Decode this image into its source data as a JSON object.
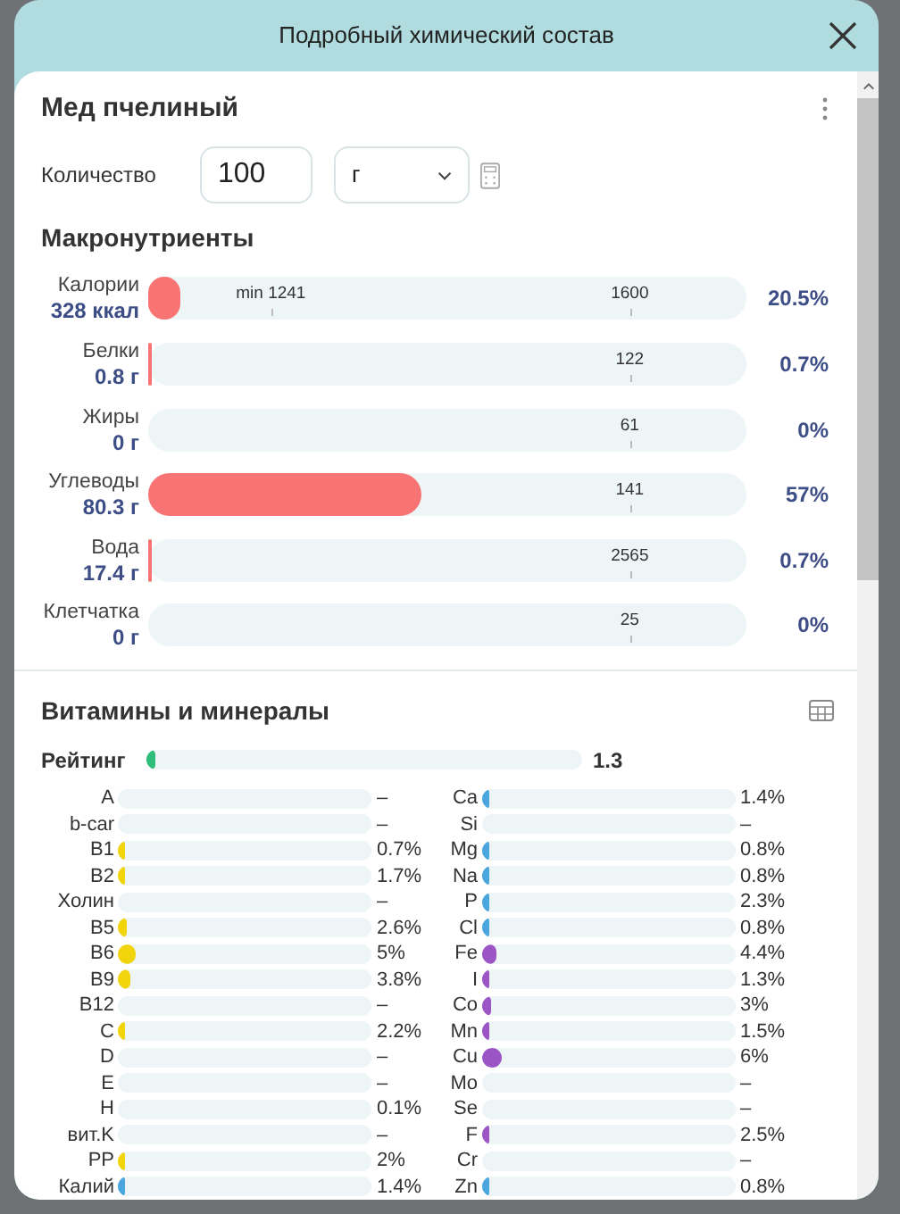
{
  "dialog": {
    "title": "Подробный химический состав"
  },
  "product": {
    "name": "Мед пчелиный",
    "quantity_label": "Количество",
    "quantity": "100",
    "unit": "г"
  },
  "macros": {
    "title": "Макронутриенты",
    "rows": [
      {
        "name": "Калории",
        "amount": "328 ккал",
        "level": 0.055,
        "markers": [
          {
            "kind": "min",
            "label": "min 1241"
          },
          {
            "kind": "target",
            "label": "1600"
          }
        ],
        "percent": "20.5%"
      },
      {
        "name": "Белки",
        "amount": "0.8 г",
        "level": 0.006,
        "markers": [
          {
            "kind": "target",
            "label": "122"
          }
        ],
        "percent": "0.7%"
      },
      {
        "name": "Жиры",
        "amount": "0 г",
        "markers": [
          {
            "kind": "target",
            "label": "61"
          }
        ],
        "percent": "0%"
      },
      {
        "name": "Углеводы",
        "amount": "80.3 г",
        "level": 0.456,
        "markers": [
          {
            "kind": "target",
            "label": "141"
          }
        ],
        "percent": "57%"
      },
      {
        "name": "Вода",
        "amount": "17.4 г",
        "level": 0.006,
        "markers": [
          {
            "kind": "target",
            "label": "2565"
          }
        ],
        "percent": "0.7%"
      },
      {
        "name": "Клетчатка",
        "amount": "0 г",
        "markers": [
          {
            "kind": "target",
            "label": "25"
          }
        ],
        "percent": "0%"
      }
    ]
  },
  "micros": {
    "title": "Витамины и минералы",
    "rating": {
      "label": "Рейтинг",
      "level": 0.02,
      "value": "1.3"
    },
    "left": [
      {
        "name": "A",
        "value": "–"
      },
      {
        "name": "b-car",
        "value": "–"
      },
      {
        "name": "B1",
        "value": "0.7%",
        "level": 0.015,
        "kind": "vitamin"
      },
      {
        "name": "B2",
        "value": "1.7%",
        "level": 0.025,
        "kind": "vitamin"
      },
      {
        "name": "Холин",
        "value": "–"
      },
      {
        "name": "B5",
        "value": "2.6%",
        "level": 0.035,
        "kind": "vitamin"
      },
      {
        "name": "B6",
        "value": "5%",
        "level": 0.07,
        "kind": "vitamin"
      },
      {
        "name": "B9",
        "value": "3.8%",
        "level": 0.05,
        "kind": "vitamin"
      },
      {
        "name": "B12",
        "value": "–"
      },
      {
        "name": "C",
        "value": "2.2%",
        "level": 0.03,
        "kind": "vitamin"
      },
      {
        "name": "D",
        "value": "–"
      },
      {
        "name": "E",
        "value": "–"
      },
      {
        "name": "H",
        "value": "0.1%"
      },
      {
        "name": "вит.K",
        "value": "–"
      },
      {
        "name": "PP",
        "value": "2%",
        "level": 0.03,
        "kind": "vitamin"
      },
      {
        "name": "Калий",
        "value": "1.4%",
        "level": 0.02,
        "kind": "macro_mineral"
      }
    ],
    "right": [
      {
        "name": "Ca",
        "value": "1.4%",
        "level": 0.02,
        "kind": "macro_mineral"
      },
      {
        "name": "Si",
        "value": "–"
      },
      {
        "name": "Mg",
        "value": "0.8%",
        "level": 0.015,
        "kind": "macro_mineral"
      },
      {
        "name": "Na",
        "value": "0.8%",
        "level": 0.015,
        "kind": "macro_mineral"
      },
      {
        "name": "P",
        "value": "2.3%",
        "level": 0.03,
        "kind": "macro_mineral"
      },
      {
        "name": "Cl",
        "value": "0.8%",
        "level": 0.015,
        "kind": "macro_mineral"
      },
      {
        "name": "Fe",
        "value": "4.4%",
        "level": 0.06,
        "kind": "trace_mineral"
      },
      {
        "name": "I",
        "value": "1.3%",
        "level": 0.02,
        "kind": "trace_mineral"
      },
      {
        "name": "Co",
        "value": "3%",
        "level": 0.04,
        "kind": "trace_mineral"
      },
      {
        "name": "Mn",
        "value": "1.5%",
        "level": 0.022,
        "kind": "trace_mineral"
      },
      {
        "name": "Cu",
        "value": "6%",
        "level": 0.08,
        "kind": "trace_mineral"
      },
      {
        "name": "Mo",
        "value": "–"
      },
      {
        "name": "Se",
        "value": "–"
      },
      {
        "name": "F",
        "value": "2.5%",
        "level": 0.035,
        "kind": "trace_mineral"
      },
      {
        "name": "Cr",
        "value": "–"
      },
      {
        "name": "Zn",
        "value": "0.8%",
        "level": 0.015,
        "kind": "macro_mineral"
      }
    ]
  }
}
